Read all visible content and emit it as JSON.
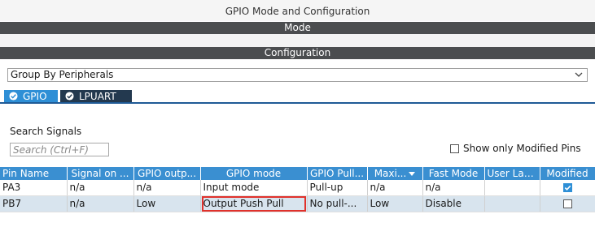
{
  "window": {
    "title": "GPIO Mode and Configuration"
  },
  "sections": {
    "mode": "Mode",
    "configuration": "Configuration"
  },
  "group_select": {
    "value": "Group By Peripherals"
  },
  "tabs": [
    {
      "label": "GPIO",
      "active": true
    },
    {
      "label": "LPUART",
      "active": false
    }
  ],
  "search": {
    "label": "Search Signals",
    "placeholder": "Search (Ctrl+F)"
  },
  "show_modified": {
    "label": "Show only Modified Pins",
    "checked": false
  },
  "table": {
    "columns": [
      "Pin Name",
      "Signal on ...",
      "GPIO outp...",
      "GPIO mode",
      "GPIO Pull...",
      "Maxi...",
      "Fast Mode",
      "User Label",
      "Modified"
    ],
    "rows": [
      {
        "pin": "PA3",
        "signal": "n/a",
        "output": "n/a",
        "mode": "Input mode",
        "pull": "Pull-up",
        "max": "n/a",
        "fast": "n/a",
        "label": "",
        "modified": true
      },
      {
        "pin": "PB7",
        "signal": "n/a",
        "output": "Low",
        "mode": "Output Push Pull",
        "pull": "No pull-...",
        "max": "Low",
        "fast": "Disable",
        "label": "",
        "modified": false
      }
    ]
  },
  "colors": {
    "section_bar": "#4b4d4f",
    "tab_active": "#2e8fd6",
    "tab_inactive": "#23394f",
    "header": "#3a8fd1",
    "selected_row": "#d8e4ee",
    "highlight": "#e0312b"
  }
}
